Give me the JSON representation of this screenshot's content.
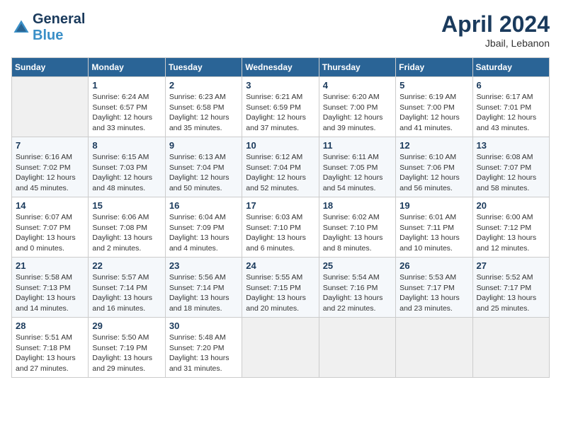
{
  "header": {
    "logo_general": "General",
    "logo_blue": "Blue",
    "month_year": "April 2024",
    "location": "Jbail, Lebanon"
  },
  "days_of_week": [
    "Sunday",
    "Monday",
    "Tuesday",
    "Wednesday",
    "Thursday",
    "Friday",
    "Saturday"
  ],
  "weeks": [
    [
      {
        "day": null
      },
      {
        "day": "1",
        "sunrise": "Sunrise: 6:24 AM",
        "sunset": "Sunset: 6:57 PM",
        "daylight": "Daylight: 12 hours and 33 minutes."
      },
      {
        "day": "2",
        "sunrise": "Sunrise: 6:23 AM",
        "sunset": "Sunset: 6:58 PM",
        "daylight": "Daylight: 12 hours and 35 minutes."
      },
      {
        "day": "3",
        "sunrise": "Sunrise: 6:21 AM",
        "sunset": "Sunset: 6:59 PM",
        "daylight": "Daylight: 12 hours and 37 minutes."
      },
      {
        "day": "4",
        "sunrise": "Sunrise: 6:20 AM",
        "sunset": "Sunset: 7:00 PM",
        "daylight": "Daylight: 12 hours and 39 minutes."
      },
      {
        "day": "5",
        "sunrise": "Sunrise: 6:19 AM",
        "sunset": "Sunset: 7:00 PM",
        "daylight": "Daylight: 12 hours and 41 minutes."
      },
      {
        "day": "6",
        "sunrise": "Sunrise: 6:17 AM",
        "sunset": "Sunset: 7:01 PM",
        "daylight": "Daylight: 12 hours and 43 minutes."
      }
    ],
    [
      {
        "day": "7",
        "sunrise": "Sunrise: 6:16 AM",
        "sunset": "Sunset: 7:02 PM",
        "daylight": "Daylight: 12 hours and 45 minutes."
      },
      {
        "day": "8",
        "sunrise": "Sunrise: 6:15 AM",
        "sunset": "Sunset: 7:03 PM",
        "daylight": "Daylight: 12 hours and 48 minutes."
      },
      {
        "day": "9",
        "sunrise": "Sunrise: 6:13 AM",
        "sunset": "Sunset: 7:04 PM",
        "daylight": "Daylight: 12 hours and 50 minutes."
      },
      {
        "day": "10",
        "sunrise": "Sunrise: 6:12 AM",
        "sunset": "Sunset: 7:04 PM",
        "daylight": "Daylight: 12 hours and 52 minutes."
      },
      {
        "day": "11",
        "sunrise": "Sunrise: 6:11 AM",
        "sunset": "Sunset: 7:05 PM",
        "daylight": "Daylight: 12 hours and 54 minutes."
      },
      {
        "day": "12",
        "sunrise": "Sunrise: 6:10 AM",
        "sunset": "Sunset: 7:06 PM",
        "daylight": "Daylight: 12 hours and 56 minutes."
      },
      {
        "day": "13",
        "sunrise": "Sunrise: 6:08 AM",
        "sunset": "Sunset: 7:07 PM",
        "daylight": "Daylight: 12 hours and 58 minutes."
      }
    ],
    [
      {
        "day": "14",
        "sunrise": "Sunrise: 6:07 AM",
        "sunset": "Sunset: 7:07 PM",
        "daylight": "Daylight: 13 hours and 0 minutes."
      },
      {
        "day": "15",
        "sunrise": "Sunrise: 6:06 AM",
        "sunset": "Sunset: 7:08 PM",
        "daylight": "Daylight: 13 hours and 2 minutes."
      },
      {
        "day": "16",
        "sunrise": "Sunrise: 6:04 AM",
        "sunset": "Sunset: 7:09 PM",
        "daylight": "Daylight: 13 hours and 4 minutes."
      },
      {
        "day": "17",
        "sunrise": "Sunrise: 6:03 AM",
        "sunset": "Sunset: 7:10 PM",
        "daylight": "Daylight: 13 hours and 6 minutes."
      },
      {
        "day": "18",
        "sunrise": "Sunrise: 6:02 AM",
        "sunset": "Sunset: 7:10 PM",
        "daylight": "Daylight: 13 hours and 8 minutes."
      },
      {
        "day": "19",
        "sunrise": "Sunrise: 6:01 AM",
        "sunset": "Sunset: 7:11 PM",
        "daylight": "Daylight: 13 hours and 10 minutes."
      },
      {
        "day": "20",
        "sunrise": "Sunrise: 6:00 AM",
        "sunset": "Sunset: 7:12 PM",
        "daylight": "Daylight: 13 hours and 12 minutes."
      }
    ],
    [
      {
        "day": "21",
        "sunrise": "Sunrise: 5:58 AM",
        "sunset": "Sunset: 7:13 PM",
        "daylight": "Daylight: 13 hours and 14 minutes."
      },
      {
        "day": "22",
        "sunrise": "Sunrise: 5:57 AM",
        "sunset": "Sunset: 7:14 PM",
        "daylight": "Daylight: 13 hours and 16 minutes."
      },
      {
        "day": "23",
        "sunrise": "Sunrise: 5:56 AM",
        "sunset": "Sunset: 7:14 PM",
        "daylight": "Daylight: 13 hours and 18 minutes."
      },
      {
        "day": "24",
        "sunrise": "Sunrise: 5:55 AM",
        "sunset": "Sunset: 7:15 PM",
        "daylight": "Daylight: 13 hours and 20 minutes."
      },
      {
        "day": "25",
        "sunrise": "Sunrise: 5:54 AM",
        "sunset": "Sunset: 7:16 PM",
        "daylight": "Daylight: 13 hours and 22 minutes."
      },
      {
        "day": "26",
        "sunrise": "Sunrise: 5:53 AM",
        "sunset": "Sunset: 7:17 PM",
        "daylight": "Daylight: 13 hours and 23 minutes."
      },
      {
        "day": "27",
        "sunrise": "Sunrise: 5:52 AM",
        "sunset": "Sunset: 7:17 PM",
        "daylight": "Daylight: 13 hours and 25 minutes."
      }
    ],
    [
      {
        "day": "28",
        "sunrise": "Sunrise: 5:51 AM",
        "sunset": "Sunset: 7:18 PM",
        "daylight": "Daylight: 13 hours and 27 minutes."
      },
      {
        "day": "29",
        "sunrise": "Sunrise: 5:50 AM",
        "sunset": "Sunset: 7:19 PM",
        "daylight": "Daylight: 13 hours and 29 minutes."
      },
      {
        "day": "30",
        "sunrise": "Sunrise: 5:48 AM",
        "sunset": "Sunset: 7:20 PM",
        "daylight": "Daylight: 13 hours and 31 minutes."
      },
      {
        "day": null
      },
      {
        "day": null
      },
      {
        "day": null
      },
      {
        "day": null
      }
    ]
  ]
}
